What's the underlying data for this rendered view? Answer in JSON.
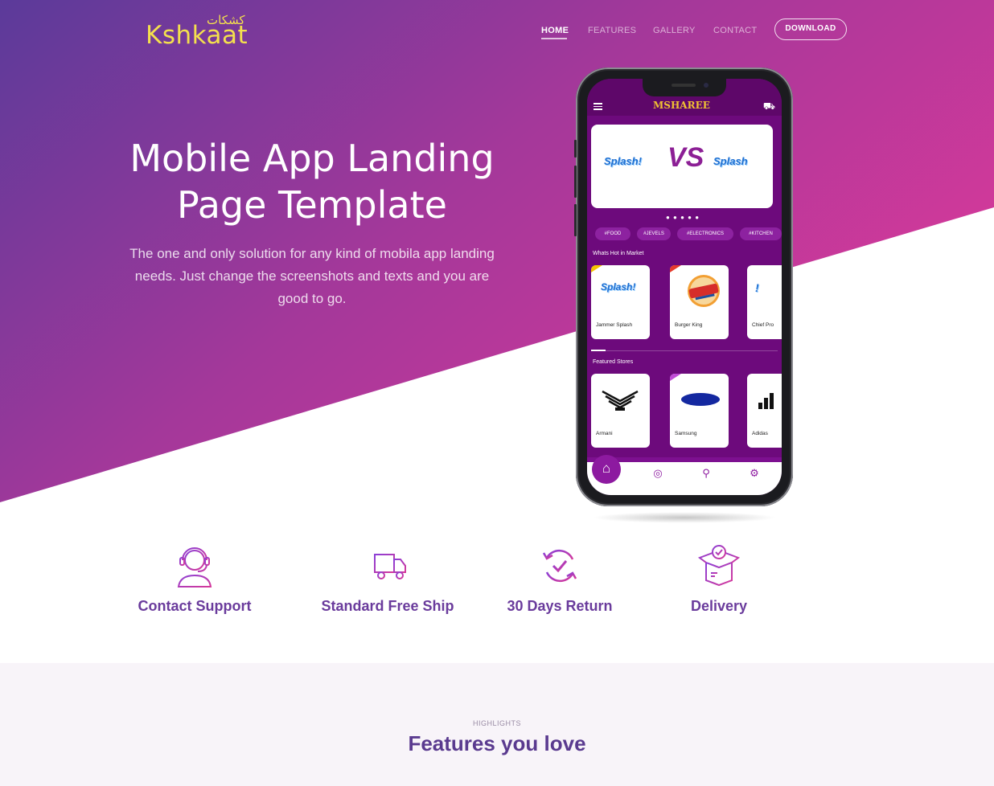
{
  "brand": {
    "name": "Kshkaat",
    "arabic_name": "كشكات",
    "logo_color": "#f4e04d"
  },
  "nav": {
    "links": [
      "HOME",
      "FEATURES",
      "GALLERY",
      "CONTACT"
    ],
    "active": "HOME",
    "download_label": "DOWNLOAD"
  },
  "hero": {
    "title_line1": "Mobile App Landing",
    "title_line2": "Page Template",
    "subtitle": "The one and only solution for any kind of mobila app landing needs. Just change the screenshots and texts and you are good to go.",
    "gradient_colors": [
      "#5b3a9a",
      "#a4389a",
      "#d8399a"
    ]
  },
  "phone_app": {
    "brand": "MSHAREE",
    "banner": {
      "left_logo": "Splash!",
      "middle": "VS",
      "right_logo": "Splash"
    },
    "tags": [
      "#FOOD",
      "#JEVELS",
      "#ELECTRONICS",
      "#KITCHEN"
    ],
    "hot_section": "Whats Hot in Market",
    "hot_items": [
      "Jammer Splash",
      "Burger King",
      "Chief Pro"
    ],
    "featured_section": "Featured Stores",
    "featured_items": [
      "Armani",
      "Samsung",
      "Adidas"
    ],
    "bottom_nav_icons": [
      "home-icon",
      "chat-icon",
      "search-icon",
      "settings-icon"
    ]
  },
  "features": [
    {
      "label": "Contact Support",
      "icon": "headset-icon"
    },
    {
      "label": "Standard Free Ship",
      "icon": "truck-icon"
    },
    {
      "label": "30 Days Return",
      "icon": "return-icon"
    },
    {
      "label": "Delivery",
      "icon": "box-icon"
    }
  ],
  "highlights": {
    "kicker": "HIGHLIGHTS",
    "title": "Features you love"
  },
  "colors": {
    "feature_text": "#6a3b9c",
    "accent_purple": "#8d1aa0",
    "highlights_bg": "#f8f4f9"
  }
}
